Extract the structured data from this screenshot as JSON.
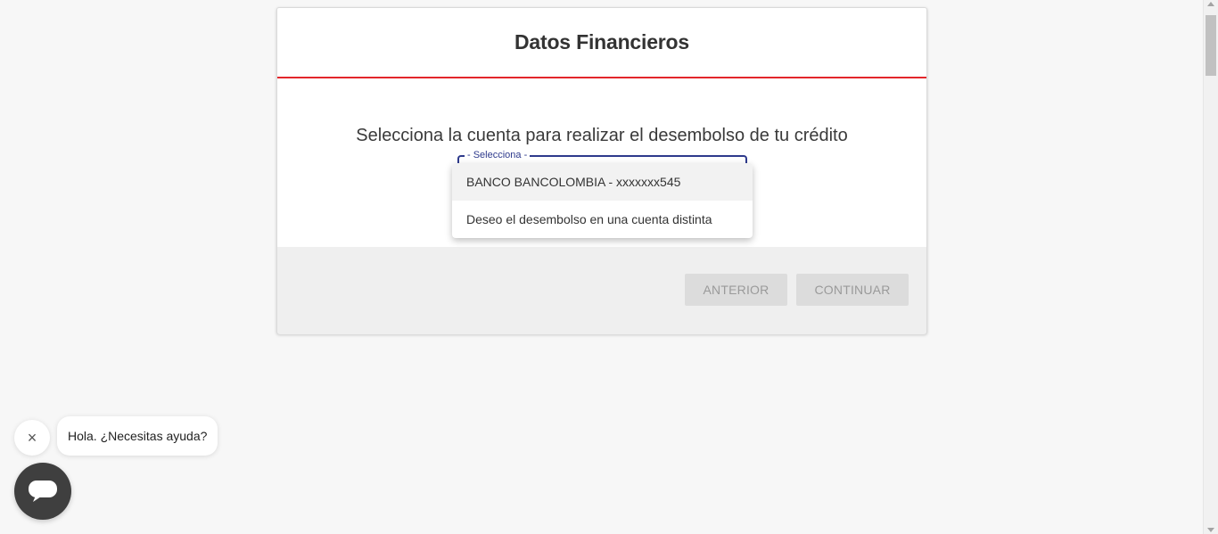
{
  "card": {
    "title": "Datos Financieros",
    "prompt": "Selecciona la cuenta para realizar el desembolso de tu crédito"
  },
  "select": {
    "label": "- Selecciona -",
    "options": [
      "BANCO BANCOLOMBIA - xxxxxxx545",
      "Deseo el desembolso en una cuenta distinta"
    ]
  },
  "footer": {
    "previous_label": "ANTERIOR",
    "continue_label": "CONTINUAR"
  },
  "chat": {
    "close_icon": "×",
    "greeting": "Hola. ¿Necesitas ayuda?"
  },
  "colors": {
    "accent_red": "#e3262b",
    "select_blue": "#2e3a8c",
    "chat_dark": "#3f3f3f"
  }
}
